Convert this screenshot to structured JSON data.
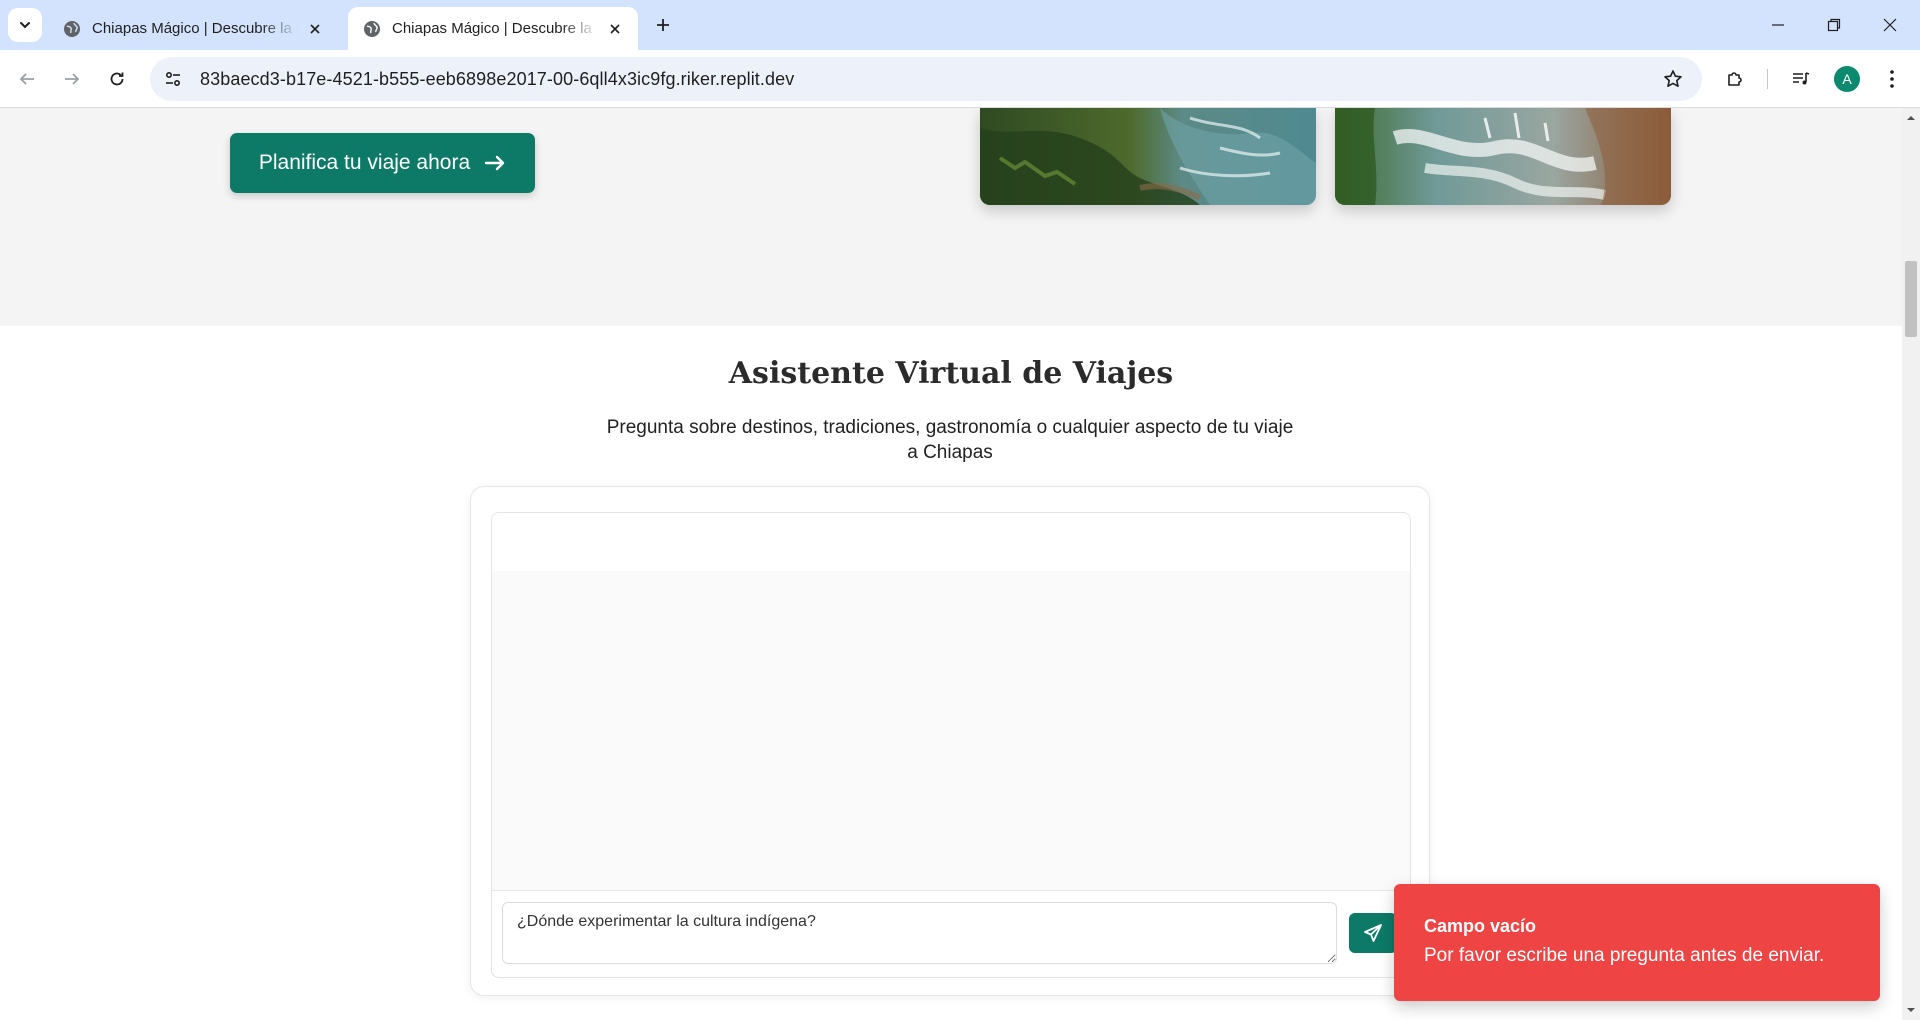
{
  "browser": {
    "tabs": [
      {
        "title": "Chiapas Mágico | Descubre la magia de Chiapas",
        "active": false
      },
      {
        "title": "Chiapas Mágico | Descubre la magia de Chiapas",
        "active": true
      }
    ],
    "url": "83baecd3-b17e-4521-b555-eeb6898e2017-00-6qll4x3ic9fg.riker.replit.dev",
    "profile_initial": "A",
    "accent_color": "#d3e3fd"
  },
  "hero": {
    "cta_label": "Planifica tu viaje ahora",
    "cta_icon": "arrow-right-icon",
    "photos": [
      "river-jungle-photo",
      "waterfall-photo"
    ]
  },
  "assistant": {
    "title": "Asistente Virtual de Viajes",
    "subtitle": "Pregunta sobre destinos, tradiciones, gastronomía o cualquier aspecto de tu viaje a Chiapas",
    "input_value": "¿Dónde experimentar la cultura indígena?",
    "send_icon": "send-icon",
    "brand_color": "#0d7a68"
  },
  "toast": {
    "title": "Campo vacío",
    "description": "Por favor escribe una pregunta antes de enviar.",
    "color": "#ef4444"
  }
}
